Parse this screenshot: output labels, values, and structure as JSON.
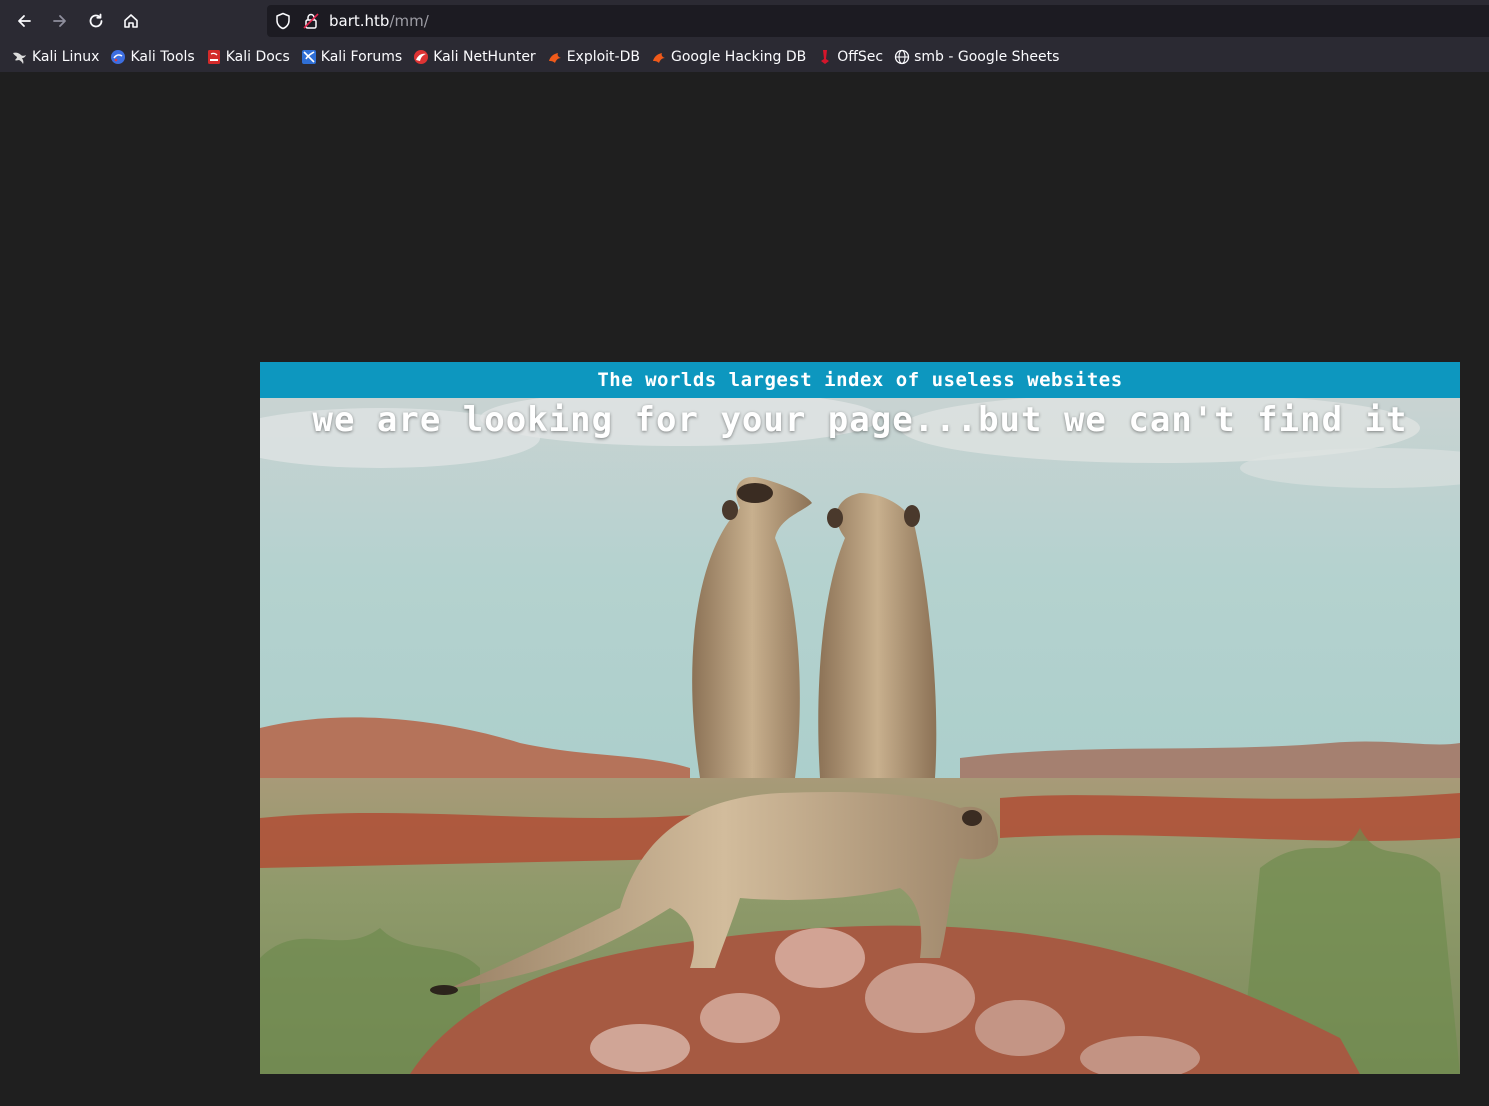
{
  "browser": {
    "url_host": "bart.htb",
    "url_path": "/mm/",
    "bookmarks": [
      {
        "label": "Kali Linux",
        "icon": "kali-dragon-icon"
      },
      {
        "label": "Kali Tools",
        "icon": "kali-tools-icon"
      },
      {
        "label": "Kali Docs",
        "icon": "kali-docs-icon"
      },
      {
        "label": "Kali Forums",
        "icon": "kali-forums-icon"
      },
      {
        "label": "Kali NetHunter",
        "icon": "kali-nethunter-icon"
      },
      {
        "label": "Exploit-DB",
        "icon": "exploit-db-icon"
      },
      {
        "label": "Google Hacking DB",
        "icon": "ghdb-icon"
      },
      {
        "label": "OffSec",
        "icon": "offsec-icon"
      },
      {
        "label": "smb - Google Sheets",
        "icon": "globe-icon"
      }
    ]
  },
  "page": {
    "header_text": "The worlds largest index of useless websites",
    "headline": "we are looking for your page...but we can't find it"
  },
  "colors": {
    "header_bar": "#0d97bf",
    "page_background": "#1f1f1f",
    "chrome_background": "#2b2a33"
  }
}
